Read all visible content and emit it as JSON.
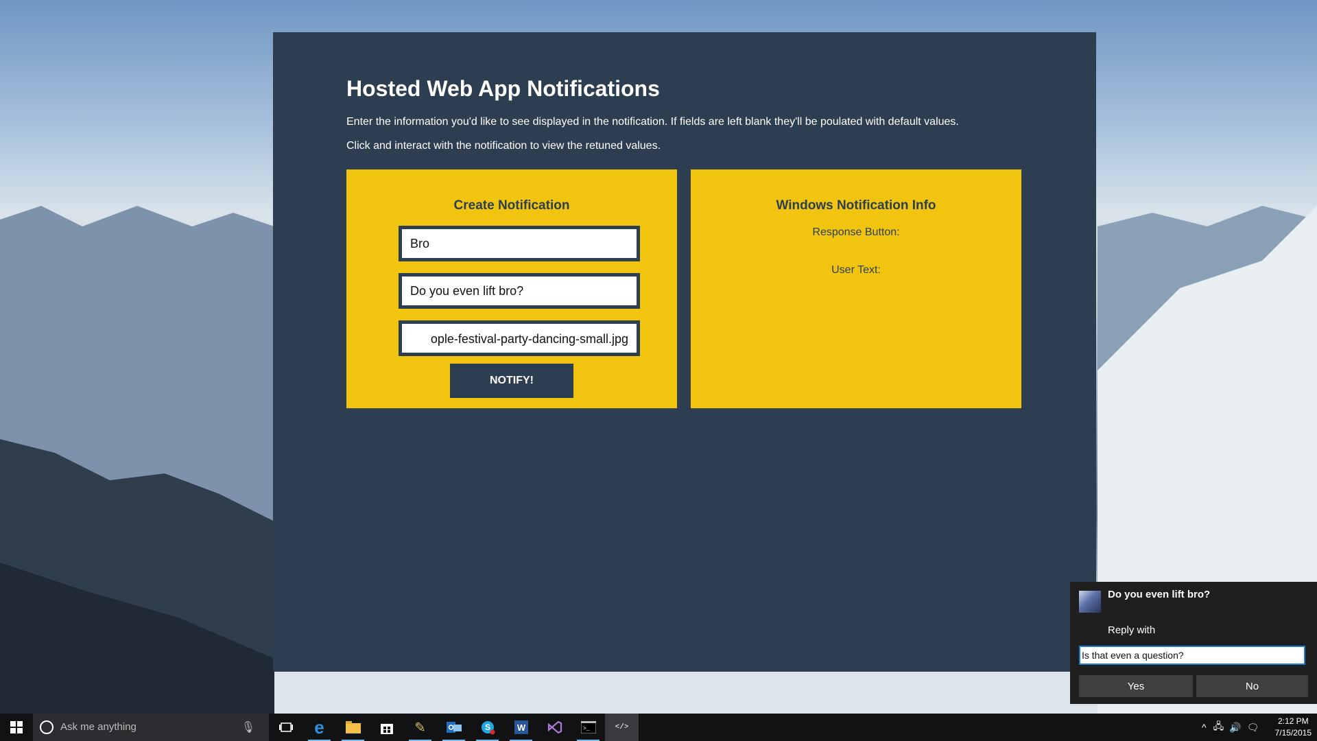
{
  "app": {
    "title": "Hosted Web App Notifications",
    "description_1": "Enter the information you'd like to see displayed in the notification. If fields are left blank they'll be poulated with default values.",
    "description_2": "Click and interact with the notification to view the retuned values.",
    "create_panel": {
      "title": "Create Notification",
      "field_title_value": "Bro",
      "field_message_value": "Do you even lift bro?",
      "field_image_value": "ople-festival-party-dancing-small.jpg",
      "notify_label": "NOTIFY!"
    },
    "info_panel": {
      "title": "Windows Notification Info",
      "response_button_label": "Response Button:",
      "user_text_label": "User Text:"
    }
  },
  "toast": {
    "title": "Do you even lift bro?",
    "subtitle": "Reply with",
    "input_value": "Is that even a question?",
    "yes_label": "Yes",
    "no_label": "No"
  },
  "taskbar": {
    "search_placeholder": "Ask me anything",
    "time": "2:12 PM",
    "date": "7/15/2015",
    "icons": [
      "windows-start-icon",
      "task-view-icon",
      "edge-icon",
      "file-explorer-icon",
      "store-icon",
      "pin-app-icon",
      "outlook-icon",
      "skype-icon",
      "word-icon",
      "visual-studio-icon",
      "command-prompt-icon",
      "web-app-icon"
    ]
  },
  "colors": {
    "app_background": "#2d3e50",
    "panel_yellow": "#f1c40f",
    "toast_background": "#1f1f1f",
    "taskbar_background": "#101214",
    "accent_blue": "#1c7fd6"
  }
}
